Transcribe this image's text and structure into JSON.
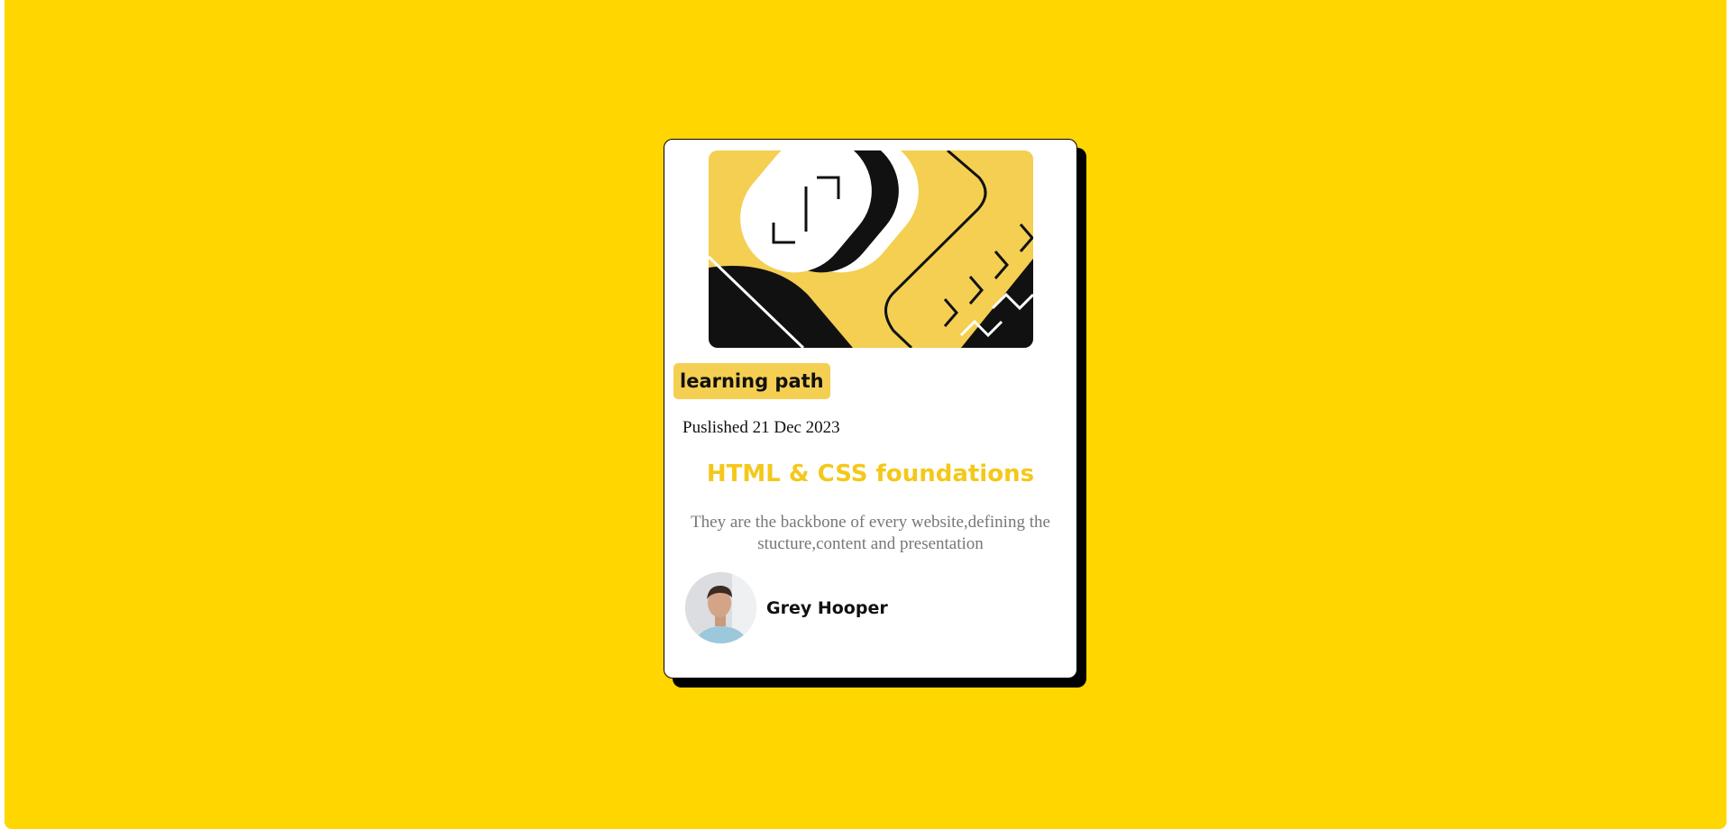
{
  "card": {
    "tag": "learning path",
    "published": "Puslished 21 Dec 2023",
    "title": "HTML & CSS foundations",
    "description": "They are the backbone of every website,defining the stucture,content and presentation",
    "author": {
      "name": "Grey Hooper"
    }
  },
  "colors": {
    "page_background": "#ffd600",
    "accent": "#f4cf52",
    "title": "#f4c81a",
    "card_background": "#ffffff",
    "shadow": "#000000"
  },
  "icons": {
    "hero": "code-illustration",
    "avatar": "author-portrait"
  }
}
